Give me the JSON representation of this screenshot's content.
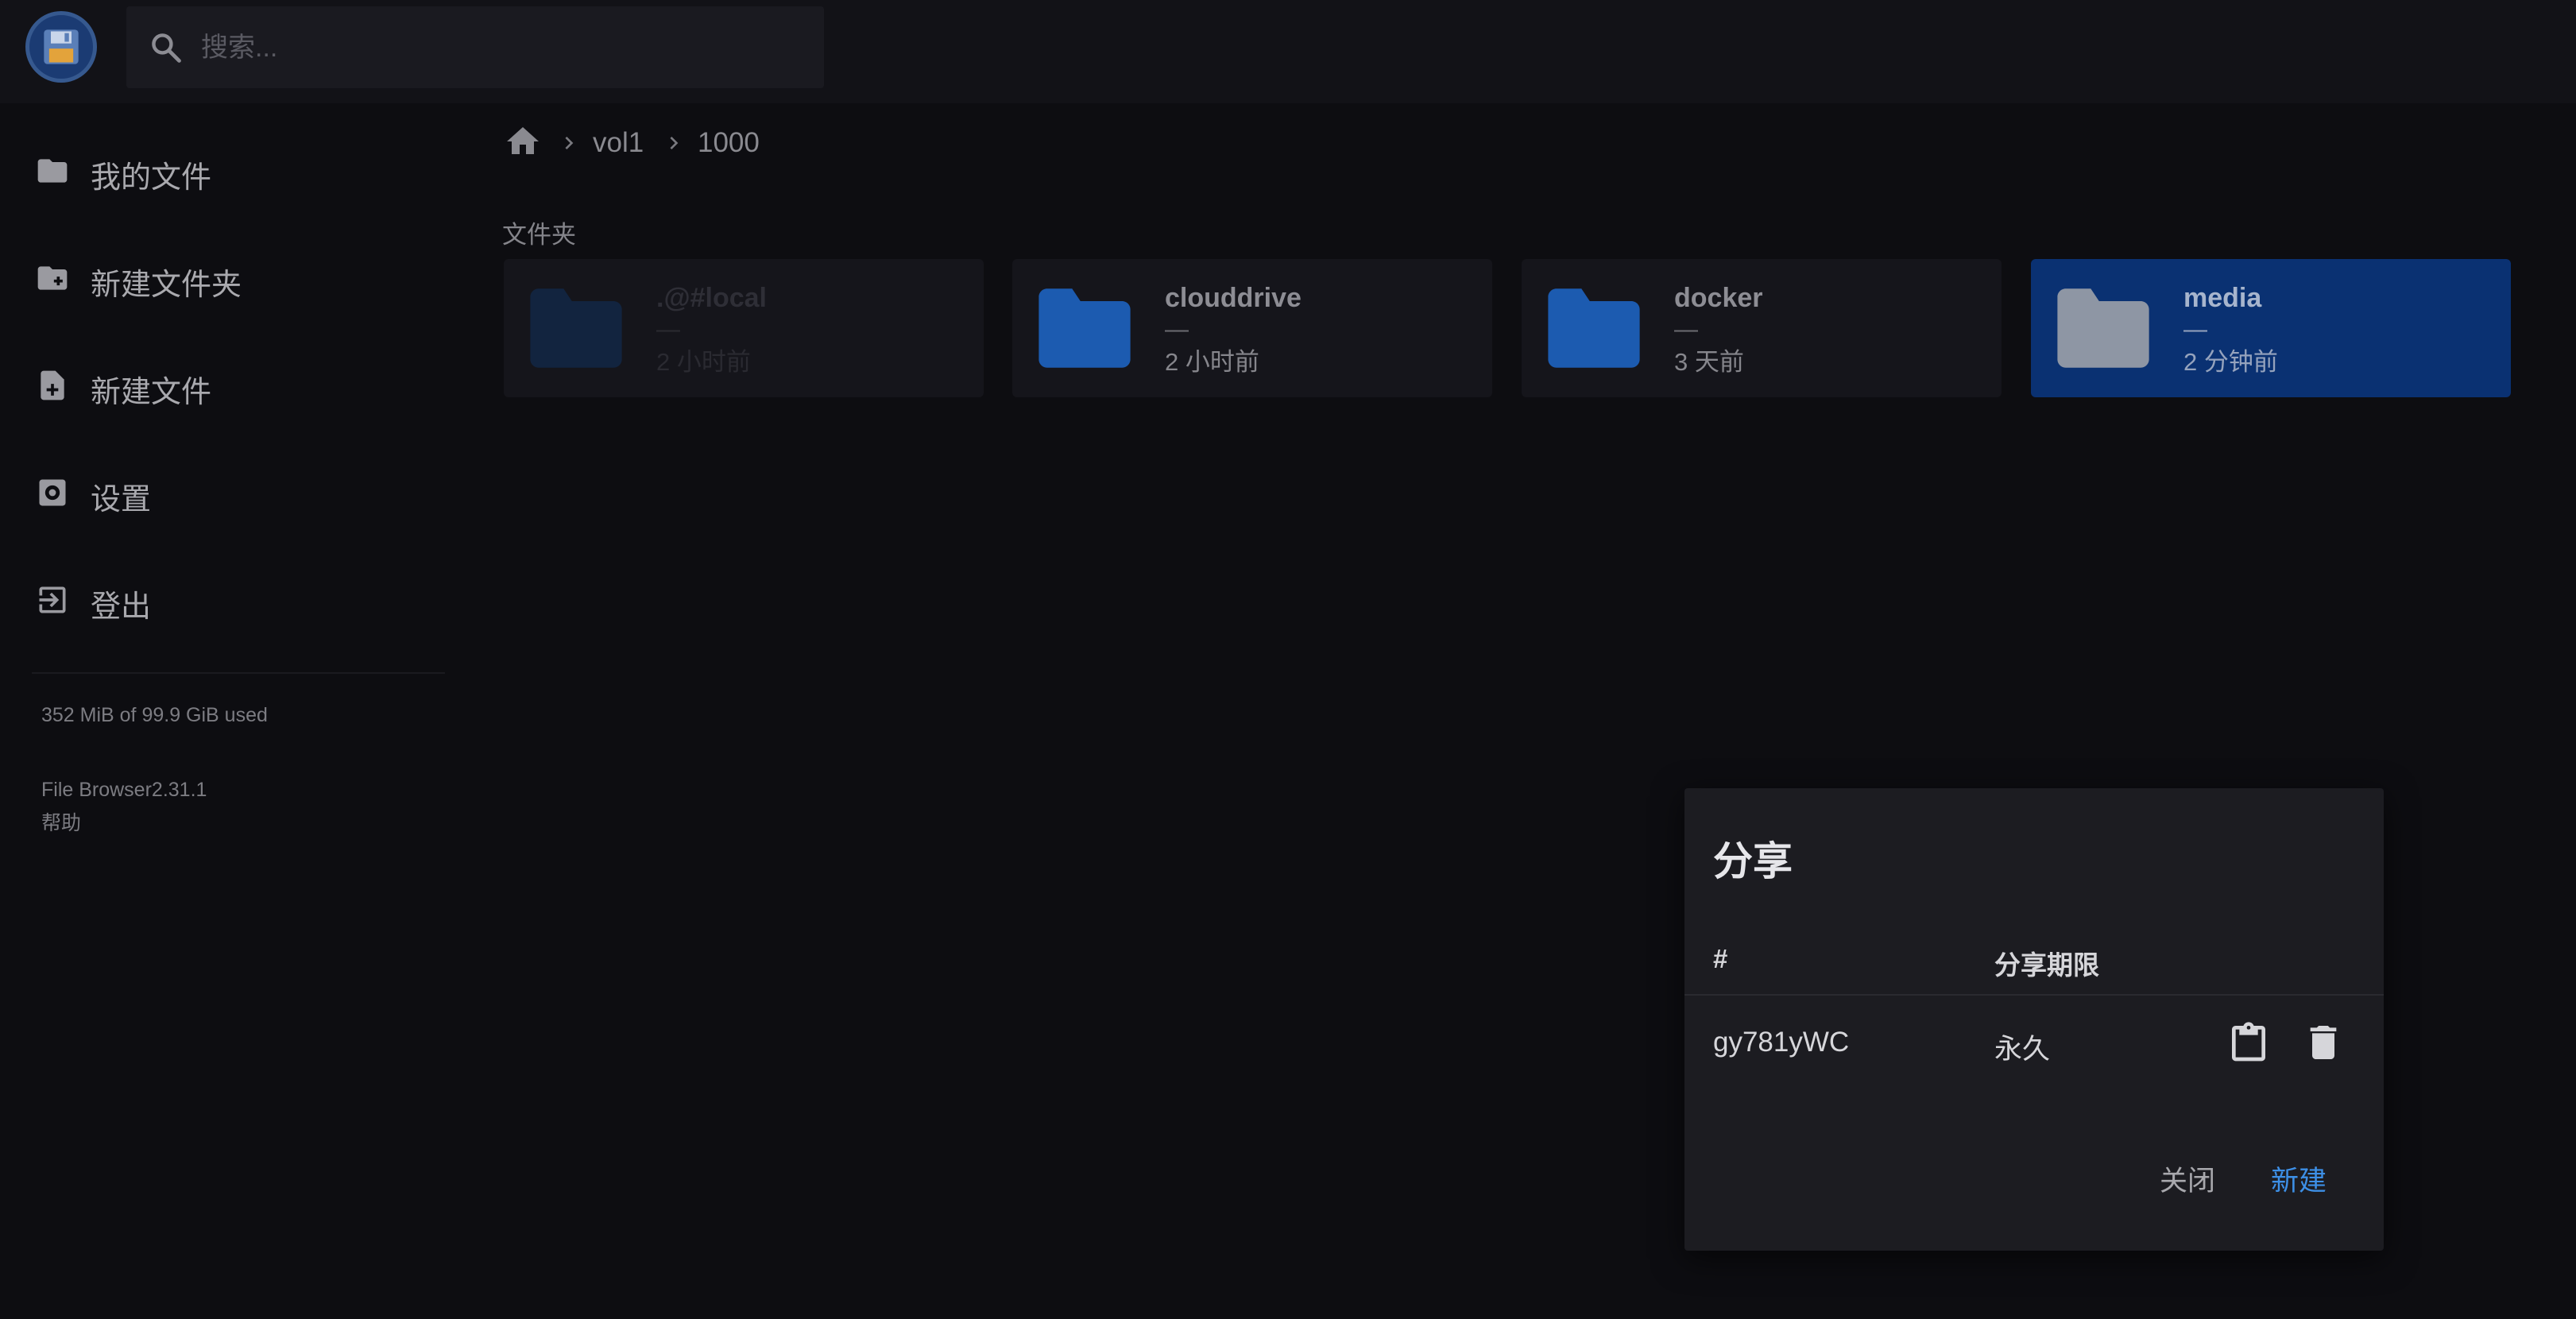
{
  "header": {
    "search_placeholder": "搜索..."
  },
  "sidebar": {
    "items": [
      {
        "label": "我的文件",
        "icon": "folder-icon"
      },
      {
        "label": "新建文件夹",
        "icon": "create-folder-icon"
      },
      {
        "label": "新建文件",
        "icon": "note-add-icon"
      },
      {
        "label": "设置",
        "icon": "settings-icon"
      },
      {
        "label": "登出",
        "icon": "logout-icon"
      }
    ],
    "usage": "352 MiB of 99.9 GiB used",
    "version": "File Browser2.31.1",
    "help": "帮助"
  },
  "breadcrumb": [
    "vol1",
    "1000"
  ],
  "main": {
    "section_title": "文件夹",
    "folders": [
      {
        "name": ".@#local",
        "size": "—",
        "modified": "2 小时前"
      },
      {
        "name": "clouddrive",
        "size": "—",
        "modified": "2 小时前"
      },
      {
        "name": "docker",
        "size": "—",
        "modified": "3 天前"
      },
      {
        "name": "media",
        "size": "—",
        "modified": "2 分钟前"
      }
    ]
  },
  "dialog": {
    "title": "分享",
    "columns": [
      "#",
      "分享期限"
    ],
    "rows": [
      {
        "hash": "gy781yWC",
        "expiry": "永久"
      }
    ],
    "close_label": "关闭",
    "new_label": "新建"
  },
  "colors": {
    "accent": "#3d8fe6",
    "selected_card": "#0a3172",
    "folder_blue": "#1c5bb0"
  }
}
